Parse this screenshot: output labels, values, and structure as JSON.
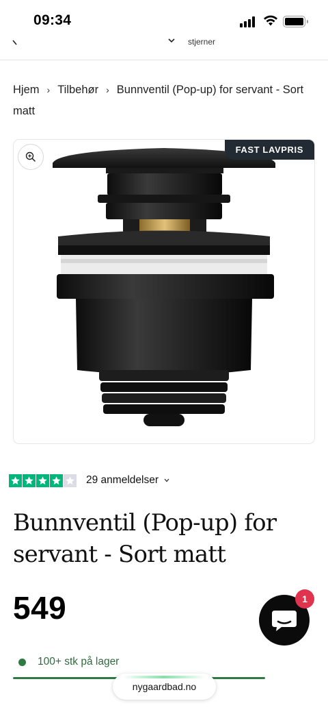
{
  "status_bar": {
    "time": "09:34"
  },
  "top_strip": {
    "text": "stjerner"
  },
  "breadcrumb": {
    "items": [
      "Hjem",
      "Tilbehør",
      "Bunnventil (Pop-up) for servant - Sort matt"
    ],
    "separator": "›"
  },
  "gallery": {
    "badge": "FAST LAVPRIS"
  },
  "product": {
    "rating": 4,
    "rating_max": 5,
    "reviews_label": "29 anmeldelser",
    "title_line1": "Bunnventil (Pop-up) for",
    "title_line2": "servant - Sort matt",
    "price": "549",
    "stock_text": "100+ stk på lager"
  },
  "chat": {
    "badge_count": "1"
  },
  "browser": {
    "url": "nygaardbad.no"
  },
  "colors": {
    "badge_bg": "#222a33",
    "star_green": "#00b67a",
    "star_empty": "#dcdce6",
    "stock_green": "#2f7a43",
    "chat_badge": "#e0334d"
  },
  "icons": [
    "back-chevron-icon",
    "chevron-down-icon",
    "zoom-icon",
    "star-icon",
    "chat-icon"
  ]
}
